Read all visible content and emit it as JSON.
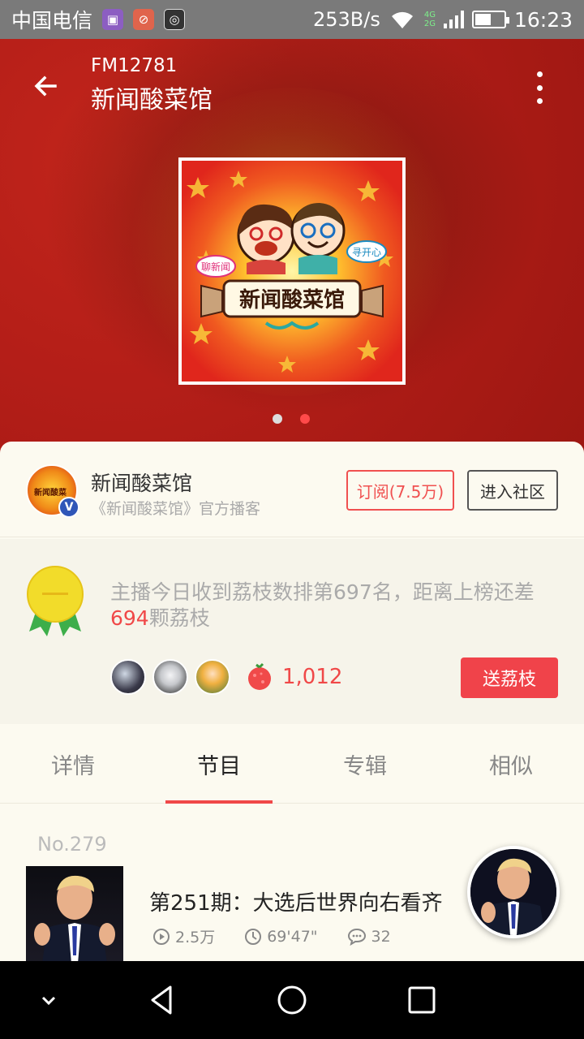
{
  "status_bar": {
    "carrier": "中国电信",
    "net_speed": "253B/s",
    "signal_badge_top": "4G",
    "signal_badge_bottom": "2G",
    "time": "16:23",
    "battery_level": 0.55
  },
  "header": {
    "station_id": "FM12781",
    "title": "新闻酸菜馆",
    "carousel_total": 2,
    "carousel_active": 2
  },
  "cover": {
    "main_text": "新闻酸菜馆",
    "left_bubble": "聊新闻",
    "right_bubble": "寻开心"
  },
  "podcaster": {
    "name": "新闻酸菜馆",
    "subtitle": "《新闻酸菜馆》官方播客",
    "avatar_text": "新闻酸菜",
    "verified_badge": "V",
    "subscribe_label": "订阅(7.5万)",
    "community_label": "进入社区"
  },
  "ranking": {
    "text_before": "主播今日收到荔枝数排第697名，距离上榜还差",
    "gap_number": "694",
    "text_after": "颗荔枝",
    "lychee_count": "1,012",
    "send_label": "送荔枝",
    "medal_color": "#f2dc2a"
  },
  "tabs": [
    {
      "label": "详情",
      "active": false
    },
    {
      "label": "节目",
      "active": true
    },
    {
      "label": "专辑",
      "active": false
    },
    {
      "label": "相似",
      "active": false
    }
  ],
  "episode": {
    "number": "No.279",
    "title": "第251期：大选后世界向右看齐",
    "plays": "2.5万",
    "duration": "69'47\"",
    "comments": "32"
  },
  "colors": {
    "accent": "#f04848",
    "hero_red": "#b41e18",
    "card_bg": "#fcfaf0"
  }
}
